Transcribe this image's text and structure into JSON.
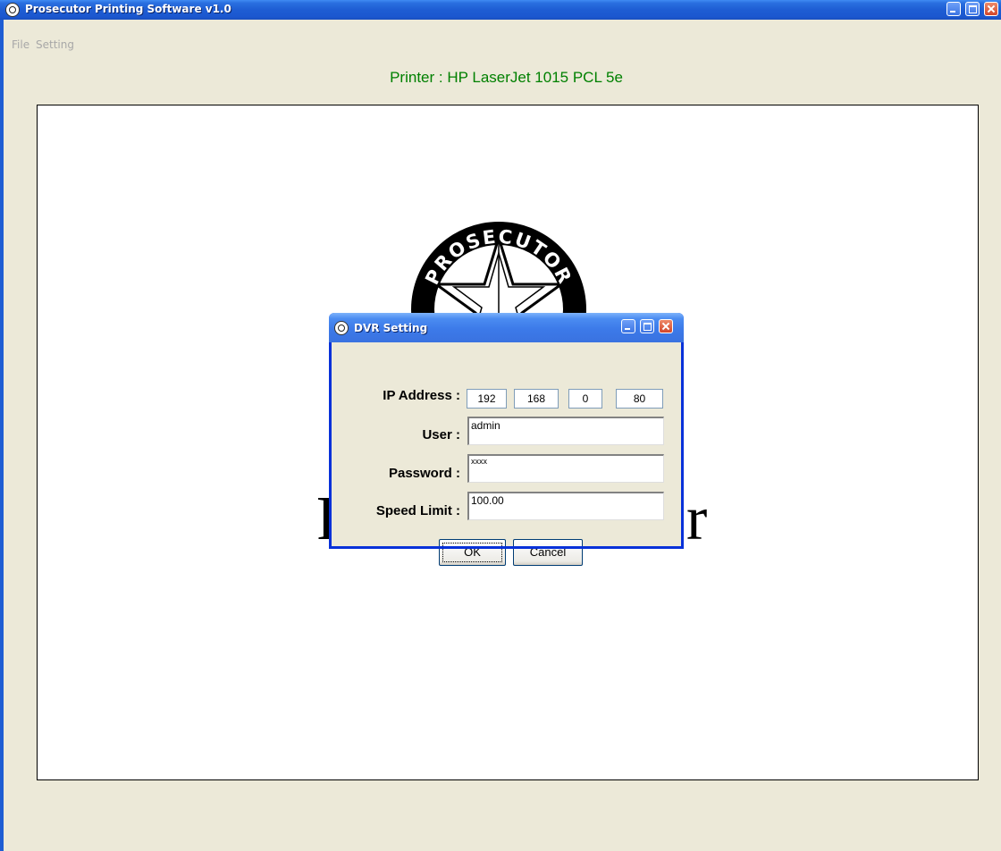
{
  "window": {
    "title": "Prosecutor Printing Software v1.0"
  },
  "menu": {
    "items": [
      "File",
      "Setting"
    ]
  },
  "printer_label": "Printer : HP LaserJet 1015 PCL 5e",
  "logo": {
    "text": "PROSECUTOR"
  },
  "canvas": {
    "text_left": "P",
    "text_right": "r"
  },
  "dialog": {
    "title": "DVR Setting",
    "ip_label": "IP Address :",
    "ip": [
      "192",
      "168",
      "0",
      "80"
    ],
    "user_label": "User :",
    "user_value": "admin",
    "password_label": "Password :",
    "password_value": "xxxx",
    "speed_label": "Speed Limit :",
    "speed_value": "100.00",
    "ok_label": "OK",
    "cancel_label": "Cancel"
  },
  "colors": {
    "title_blue": "#1E5DD3",
    "printer_label_green": "#008000",
    "face": "#ECE9D8"
  }
}
